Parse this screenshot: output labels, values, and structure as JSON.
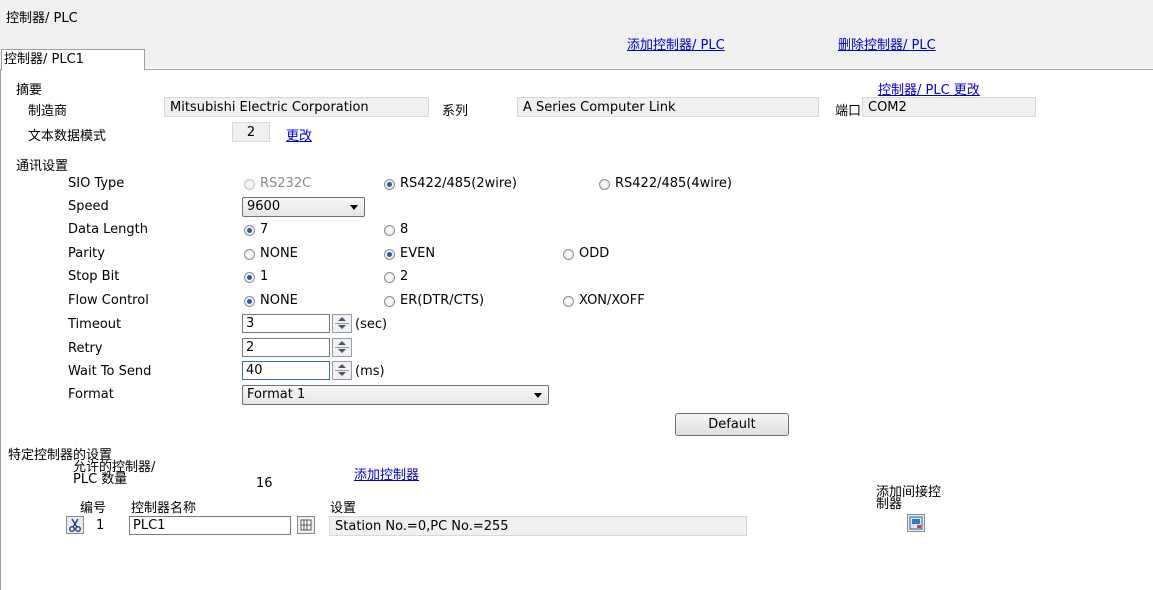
{
  "header": {
    "title": "控制器/ PLC",
    "add_link": "添加控制器/ PLC",
    "delete_link": "删除控制器/ PLC",
    "tab": "控制器/ PLC1"
  },
  "summary": {
    "heading": "摘要",
    "change_link": "控制器/ PLC 更改",
    "manufacturer_label": "制造商",
    "manufacturer": "Mitsubishi Electric Corporation",
    "series_label": "系列",
    "series": "A Series Computer Link",
    "port_label": "端口",
    "port": "COM2",
    "text_mode_label": "文本数据模式",
    "text_mode": "2",
    "text_mode_change": "更改"
  },
  "comm": {
    "heading": "通讯设置",
    "sio_type": {
      "label": "SIO Type",
      "options": [
        "RS232C",
        "RS422/485(2wire)",
        "RS422/485(4wire)"
      ],
      "selected": "RS422/485(2wire)"
    },
    "speed": {
      "label": "Speed",
      "value": "9600"
    },
    "data_length": {
      "label": "Data Length",
      "options": [
        "7",
        "8"
      ],
      "selected": "7"
    },
    "parity": {
      "label": "Parity",
      "options": [
        "NONE",
        "EVEN",
        "ODD"
      ],
      "selected": "EVEN"
    },
    "stop_bit": {
      "label": "Stop Bit",
      "options": [
        "1",
        "2"
      ],
      "selected": "1"
    },
    "flow_control": {
      "label": "Flow Control",
      "options": [
        "NONE",
        "ER(DTR/CTS)",
        "XON/XOFF"
      ],
      "selected": "NONE"
    },
    "timeout": {
      "label": "Timeout",
      "value": "3",
      "unit": "(sec)"
    },
    "retry": {
      "label": "Retry",
      "value": "2"
    },
    "wait_to_send": {
      "label": "Wait To Send",
      "value": "40",
      "unit": "(ms)"
    },
    "format": {
      "label": "Format",
      "value": "Format 1"
    },
    "default_button": "Default"
  },
  "device": {
    "heading": "特定控制器的设置",
    "allowed_label_1": "允许的控制器/",
    "allowed_label_2": "PLC 数量",
    "allowed_count": "16",
    "add_controller_link": "添加控制器",
    "col_no": "编号",
    "col_name": "控制器名称",
    "col_settings": "设置",
    "col_indirect_1": "添加间接控",
    "col_indirect_2": "制器",
    "rows": [
      {
        "no": "1",
        "name": "PLC1",
        "settings": "Station No.=0,PC No.=255"
      }
    ]
  },
  "icons": {
    "delete_row": "cut-icon",
    "settings": "settings-grid-icon",
    "add_indirect": "add-indirect-icon"
  }
}
